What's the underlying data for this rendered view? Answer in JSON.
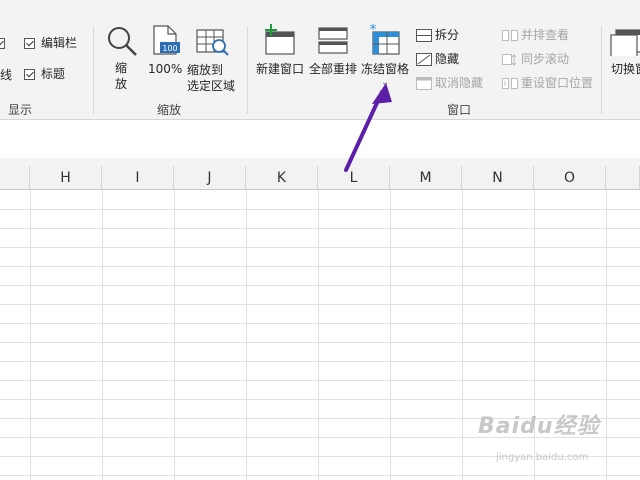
{
  "ribbon": {
    "show_group": {
      "label": "显示",
      "items": [
        {
          "label": "线",
          "checked": true
        },
        {
          "label": "编辑栏",
          "checked": true
        },
        {
          "label": "标题",
          "checked": true
        }
      ]
    },
    "zoom_group": {
      "label": "缩放",
      "zoom_label": "缩\n放",
      "zoom_100_label": "100%",
      "zoom_100_icon_text": "100",
      "zoom_selection_label": "缩放到\n选定区域"
    },
    "window_group": {
      "label": "窗口",
      "new_window_label": "新建窗口",
      "arrange_all_label": "全部重排",
      "freeze_panes_label": "冻结窗格",
      "freeze_dropdown_glyph": "⌄",
      "split_label": "拆分",
      "hide_label": "隐藏",
      "unhide_label": "取消隐藏",
      "view_side_by_side_label": "并排查看",
      "sync_scroll_label": "同步滚动",
      "reset_position_label": "重设窗口位置",
      "switch_windows_label": "切换窗"
    }
  },
  "sheet": {
    "columns": [
      "H",
      "I",
      "J",
      "K",
      "L",
      "M",
      "N",
      "O"
    ]
  },
  "watermark": {
    "text": "Baidu经验",
    "url": "jingyan.baidu.com"
  },
  "colors": {
    "arrow": "#5b1fa8",
    "freeze_icon": "#2e8fd8",
    "new_window_plus": "#1e9e3a"
  }
}
